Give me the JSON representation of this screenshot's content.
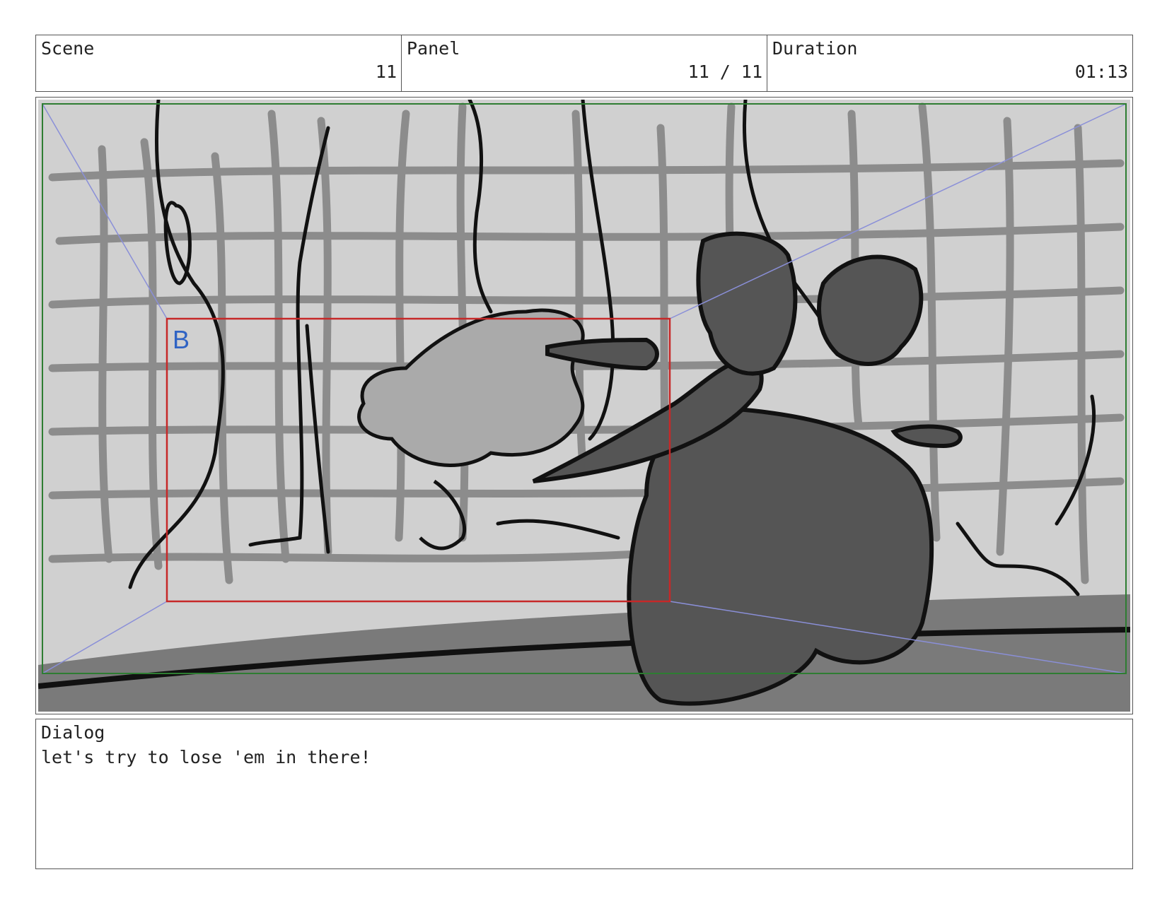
{
  "header": {
    "scene": {
      "label": "Scene",
      "value": "11"
    },
    "panel": {
      "label": "Panel",
      "value": "11 / 11"
    },
    "duration": {
      "label": "Duration",
      "value": "01:13"
    }
  },
  "frame": {
    "safe_area_label": "B",
    "colors": {
      "safe_frame": "#2e7d32",
      "camera_box": "#c62828",
      "guide_lines": "#8a8fd8",
      "label": "#2f63c4"
    }
  },
  "dialog": {
    "label": "Dialog",
    "text": "let's try to lose 'em in there!"
  }
}
